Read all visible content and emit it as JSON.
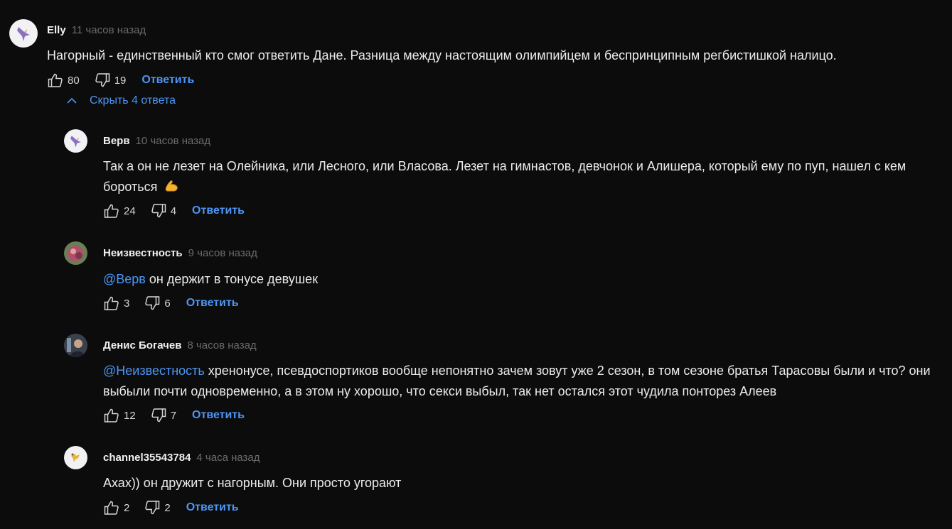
{
  "comments": [
    {
      "author": "Elly",
      "time": "11 часов назад",
      "text": "Нагорный - единственный кто смог ответить Дане. Разница между настоящим олимпийцем и беспринципным регбистишкой налицо.",
      "likes": "80",
      "dislikes": "19",
      "reply_label": "Ответить",
      "avatar_icon": "hummingbird-icon"
    }
  ],
  "thread_toggle": "Скрыть 4 ответа",
  "replies": [
    {
      "author": "Верв",
      "time": "10 часов назад",
      "text": "Так а он не лезет на Олейника, или Лесного, или Власова. Лезет на гимнастов, девчонок и Алишера, который ему по пуп, нашел с кем бороться",
      "emoji_icon": "flexed-biceps-icon",
      "likes": "24",
      "dislikes": "4",
      "reply_label": "Ответить",
      "avatar_icon": "hummingbird-icon"
    },
    {
      "author": "Неизвестность",
      "time": "9 часов назад",
      "mention": "@Верв",
      "text": " он держит в тонусе девушек",
      "likes": "3",
      "dislikes": "6",
      "reply_label": "Ответить",
      "avatar_icon": "photo-avatar"
    },
    {
      "author": "Денис Богачев",
      "time": "8 часов назад",
      "mention": "@Неизвестность",
      "text": " хренонусе, псевдоспортиков вообще непонятно зачем зовут уже 2 сезон, в том сезоне братья Тарасовы были и что? они выбыли почти одновременно, а в этом ну хорошо, что секси выбыл, так нет остался этот чудила понторез Алеев",
      "likes": "12",
      "dislikes": "7",
      "reply_label": "Ответить",
      "avatar_icon": "photo-avatar"
    },
    {
      "author": "channel35543784",
      "time": "4 часа назад",
      "text": "Ахах)) он дружит с нагорным. Они просто угорают",
      "likes": "2",
      "dislikes": "2",
      "reply_label": "Ответить",
      "avatar_icon": "bird-icon"
    }
  ],
  "colors": {
    "background": "#0c0c0d",
    "link": "#4c96f5",
    "muted": "#6b6b6f"
  }
}
